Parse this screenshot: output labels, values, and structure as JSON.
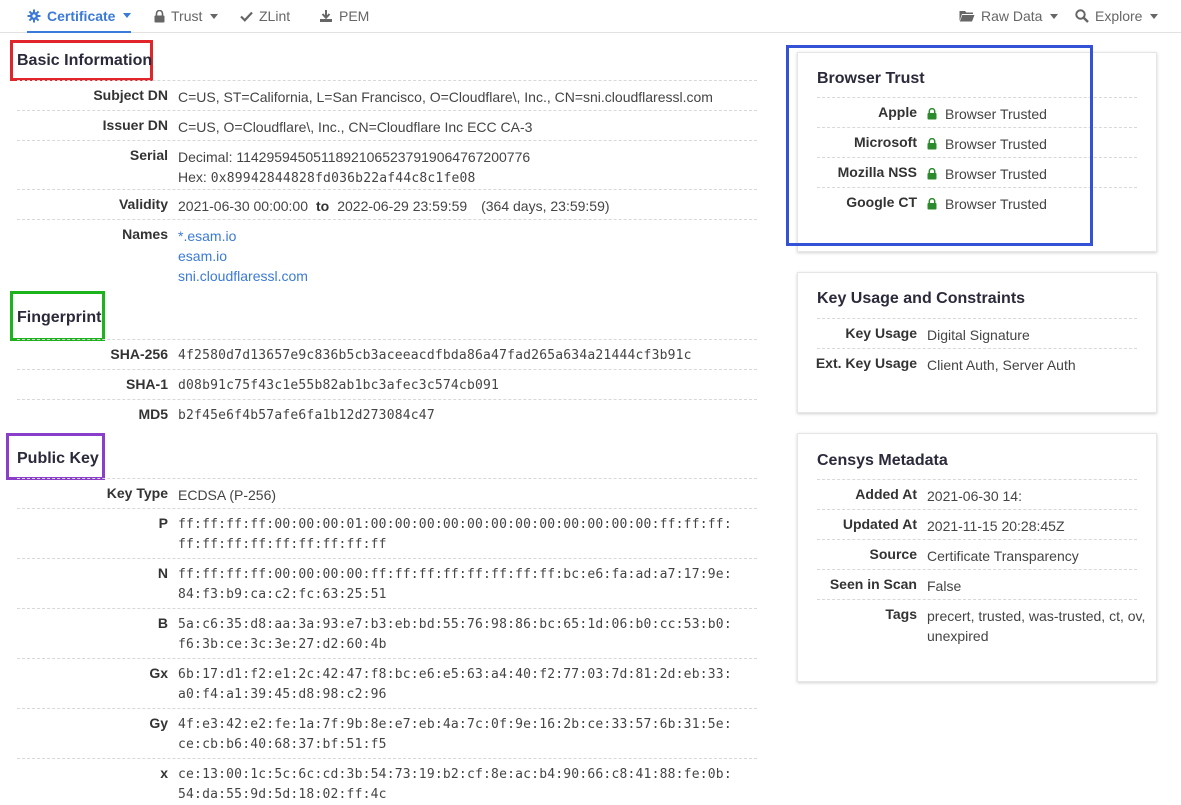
{
  "nav": {
    "tabs": [
      {
        "label": "Certificate",
        "icon": "gear-icon"
      },
      {
        "label": "Trust",
        "icon": "lock-icon"
      },
      {
        "label": "ZLint",
        "icon": "check-icon"
      },
      {
        "label": "PEM",
        "icon": "download-icon"
      }
    ],
    "right": [
      {
        "label": "Raw Data",
        "icon": "folder-icon"
      },
      {
        "label": "Explore",
        "icon": "search-icon"
      }
    ]
  },
  "colors": {
    "accent": "#3b7ad6",
    "trusted": "#2b8a2b",
    "box_basic": "#e0262a",
    "box_fingerprint": "#1db31d",
    "box_publickey": "#8a3ec9",
    "box_trust": "#3352d6"
  },
  "basic": {
    "title": "Basic Information",
    "subject_dn": {
      "label": "Subject DN",
      "value": "C=US, ST=California, L=San Francisco, O=Cloudflare\\, Inc., CN=sni.cloudflaressl.com"
    },
    "issuer_dn": {
      "label": "Issuer DN",
      "value": "C=US, O=Cloudflare\\, Inc., CN=Cloudflare Inc ECC CA-3"
    },
    "serial": {
      "label": "Serial",
      "decimal": "Decimal: 11429594505118921065237919064767200776",
      "hex_prefix": "Hex: ",
      "hex": "0x89942844828fd036b22af44c8c1fe08"
    },
    "validity": {
      "label": "Validity",
      "from": "2021-06-30 00:00:00",
      "to_word": "to",
      "to": "2022-06-29 23:59:59",
      "duration": "(364 days, 23:59:59)"
    },
    "names": {
      "label": "Names",
      "values": [
        "*.esam.io",
        "esam.io",
        "sni.cloudflaressl.com"
      ]
    }
  },
  "fingerprint": {
    "title": "Fingerprint",
    "rows": [
      {
        "label": "SHA-256",
        "value": "4f2580d7d13657e9c836b5cb3aceeacdfbda86a47fad265a634a21444cf3b91c"
      },
      {
        "label": "SHA-1",
        "value": "d08b91c75f43c1e55b82ab1bc3afec3c574cb091"
      },
      {
        "label": "MD5",
        "value": "b2f45e6f4b57afe6fa1b12d273084c47"
      }
    ]
  },
  "public_key": {
    "title": "Public Key",
    "key_type": {
      "label": "Key Type",
      "value": "ECDSA (P-256)"
    },
    "rows": [
      {
        "label": "P",
        "line1": "ff:ff:ff:ff:00:00:00:01:00:00:00:00:00:00:00:00:00:00:00:00:ff:ff:ff:",
        "line2": "ff:ff:ff:ff:ff:ff:ff:ff:ff"
      },
      {
        "label": "N",
        "line1": "ff:ff:ff:ff:00:00:00:00:ff:ff:ff:ff:ff:ff:ff:ff:bc:e6:fa:ad:a7:17:9e:",
        "line2": "84:f3:b9:ca:c2:fc:63:25:51"
      },
      {
        "label": "B",
        "line1": "5a:c6:35:d8:aa:3a:93:e7:b3:eb:bd:55:76:98:86:bc:65:1d:06:b0:cc:53:b0:",
        "line2": "f6:3b:ce:3c:3e:27:d2:60:4b"
      },
      {
        "label": "Gx",
        "line1": "6b:17:d1:f2:e1:2c:42:47:f8:bc:e6:e5:63:a4:40:f2:77:03:7d:81:2d:eb:33:",
        "line2": "a0:f4:a1:39:45:d8:98:c2:96"
      },
      {
        "label": "Gy",
        "line1": "4f:e3:42:e2:fe:1a:7f:9b:8e:e7:eb:4a:7c:0f:9e:16:2b:ce:33:57:6b:31:5e:",
        "line2": "ce:cb:b6:40:68:37:bf:51:f5"
      },
      {
        "label": "x",
        "line1": "ce:13:00:1c:5c:6c:cd:3b:54:73:19:b2:cf:8e:ac:b4:90:66:c8:41:88:fe:0b:",
        "line2": "54:da:55:9d:5d:18:02:ff:4c"
      }
    ]
  },
  "browser_trust": {
    "title": "Browser Trust",
    "rows": [
      {
        "label": "Apple",
        "value": "Browser Trusted"
      },
      {
        "label": "Microsoft",
        "value": "Browser Trusted"
      },
      {
        "label": "Mozilla NSS",
        "value": "Browser Trusted"
      },
      {
        "label": "Google CT",
        "value": "Browser Trusted"
      }
    ]
  },
  "key_usage": {
    "title": "Key Usage and Constraints",
    "rows": [
      {
        "label": "Key Usage",
        "value": "Digital Signature"
      },
      {
        "label": "Ext. Key Usage",
        "value": "Client Auth, Server Auth"
      }
    ]
  },
  "censys": {
    "title": "Censys Metadata",
    "rows": [
      {
        "label": "Added At",
        "value": "2021-06-30 14:"
      },
      {
        "label": "Updated At",
        "value": "2021-11-15 20:28:45Z"
      },
      {
        "label": "Source",
        "value": "Certificate Transparency"
      },
      {
        "label": "Seen in Scan",
        "value": "False"
      },
      {
        "label": "Tags",
        "line1": "precert, trusted, was-trusted, ct, ov,",
        "line2": "unexpired"
      }
    ]
  }
}
